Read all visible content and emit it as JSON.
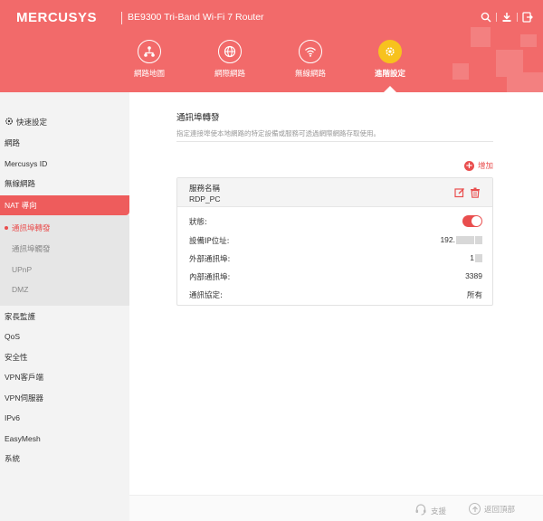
{
  "header": {
    "brand": "MERCUSYS",
    "model": "BE9300 Tri-Band Wi-Fi 7 Router",
    "icons": [
      "search-icon",
      "download-icon",
      "logout-icon"
    ],
    "color": "#f26a6a"
  },
  "nav": {
    "items": [
      {
        "label": "網路地圖",
        "icon": "network-map-icon"
      },
      {
        "label": "網際網路",
        "icon": "globe-icon"
      },
      {
        "label": "無線網路",
        "icon": "wifi-icon"
      },
      {
        "label": "進階設定",
        "icon": "gear-icon",
        "active": true
      }
    ],
    "active_color": "#f7c21e"
  },
  "sidebar": {
    "items": [
      {
        "label": "快速設定",
        "icon": "gear-icon"
      },
      {
        "label": "網路"
      },
      {
        "label": "Mercusys ID"
      },
      {
        "label": "無線網路"
      },
      {
        "label": "NAT 導向",
        "active": true
      },
      {
        "label": "家長監護"
      },
      {
        "label": "QoS"
      },
      {
        "label": "安全性"
      },
      {
        "label": "VPN客戶端"
      },
      {
        "label": "VPN伺服器"
      },
      {
        "label": "IPv6"
      },
      {
        "label": "EasyMesh"
      },
      {
        "label": "系統"
      }
    ],
    "subitems": [
      {
        "label": "通訊埠轉發",
        "active": true
      },
      {
        "label": "通訊埠觸發"
      },
      {
        "label": "UPnP"
      },
      {
        "label": "DMZ"
      }
    ]
  },
  "main": {
    "title": "通訊埠轉發",
    "description": "指定連接埠使本地網路的特定設備或服務可透過網際網路存取使用。",
    "add_label": "增加",
    "card": {
      "header_label": "服務名稱",
      "service_name": "RDP_PC",
      "rows": [
        {
          "label": "狀態:",
          "value": "",
          "toggle": true
        },
        {
          "label": "設備IP位址:",
          "value": "192."
        },
        {
          "label": "外部通訊埠:",
          "value": "1"
        },
        {
          "label": "內部通訊埠:",
          "value": "3389"
        },
        {
          "label": "通訊協定:",
          "value": "所有"
        }
      ]
    }
  },
  "footer": {
    "support_label": "支援",
    "back_to_top_label": "返回頂部"
  }
}
